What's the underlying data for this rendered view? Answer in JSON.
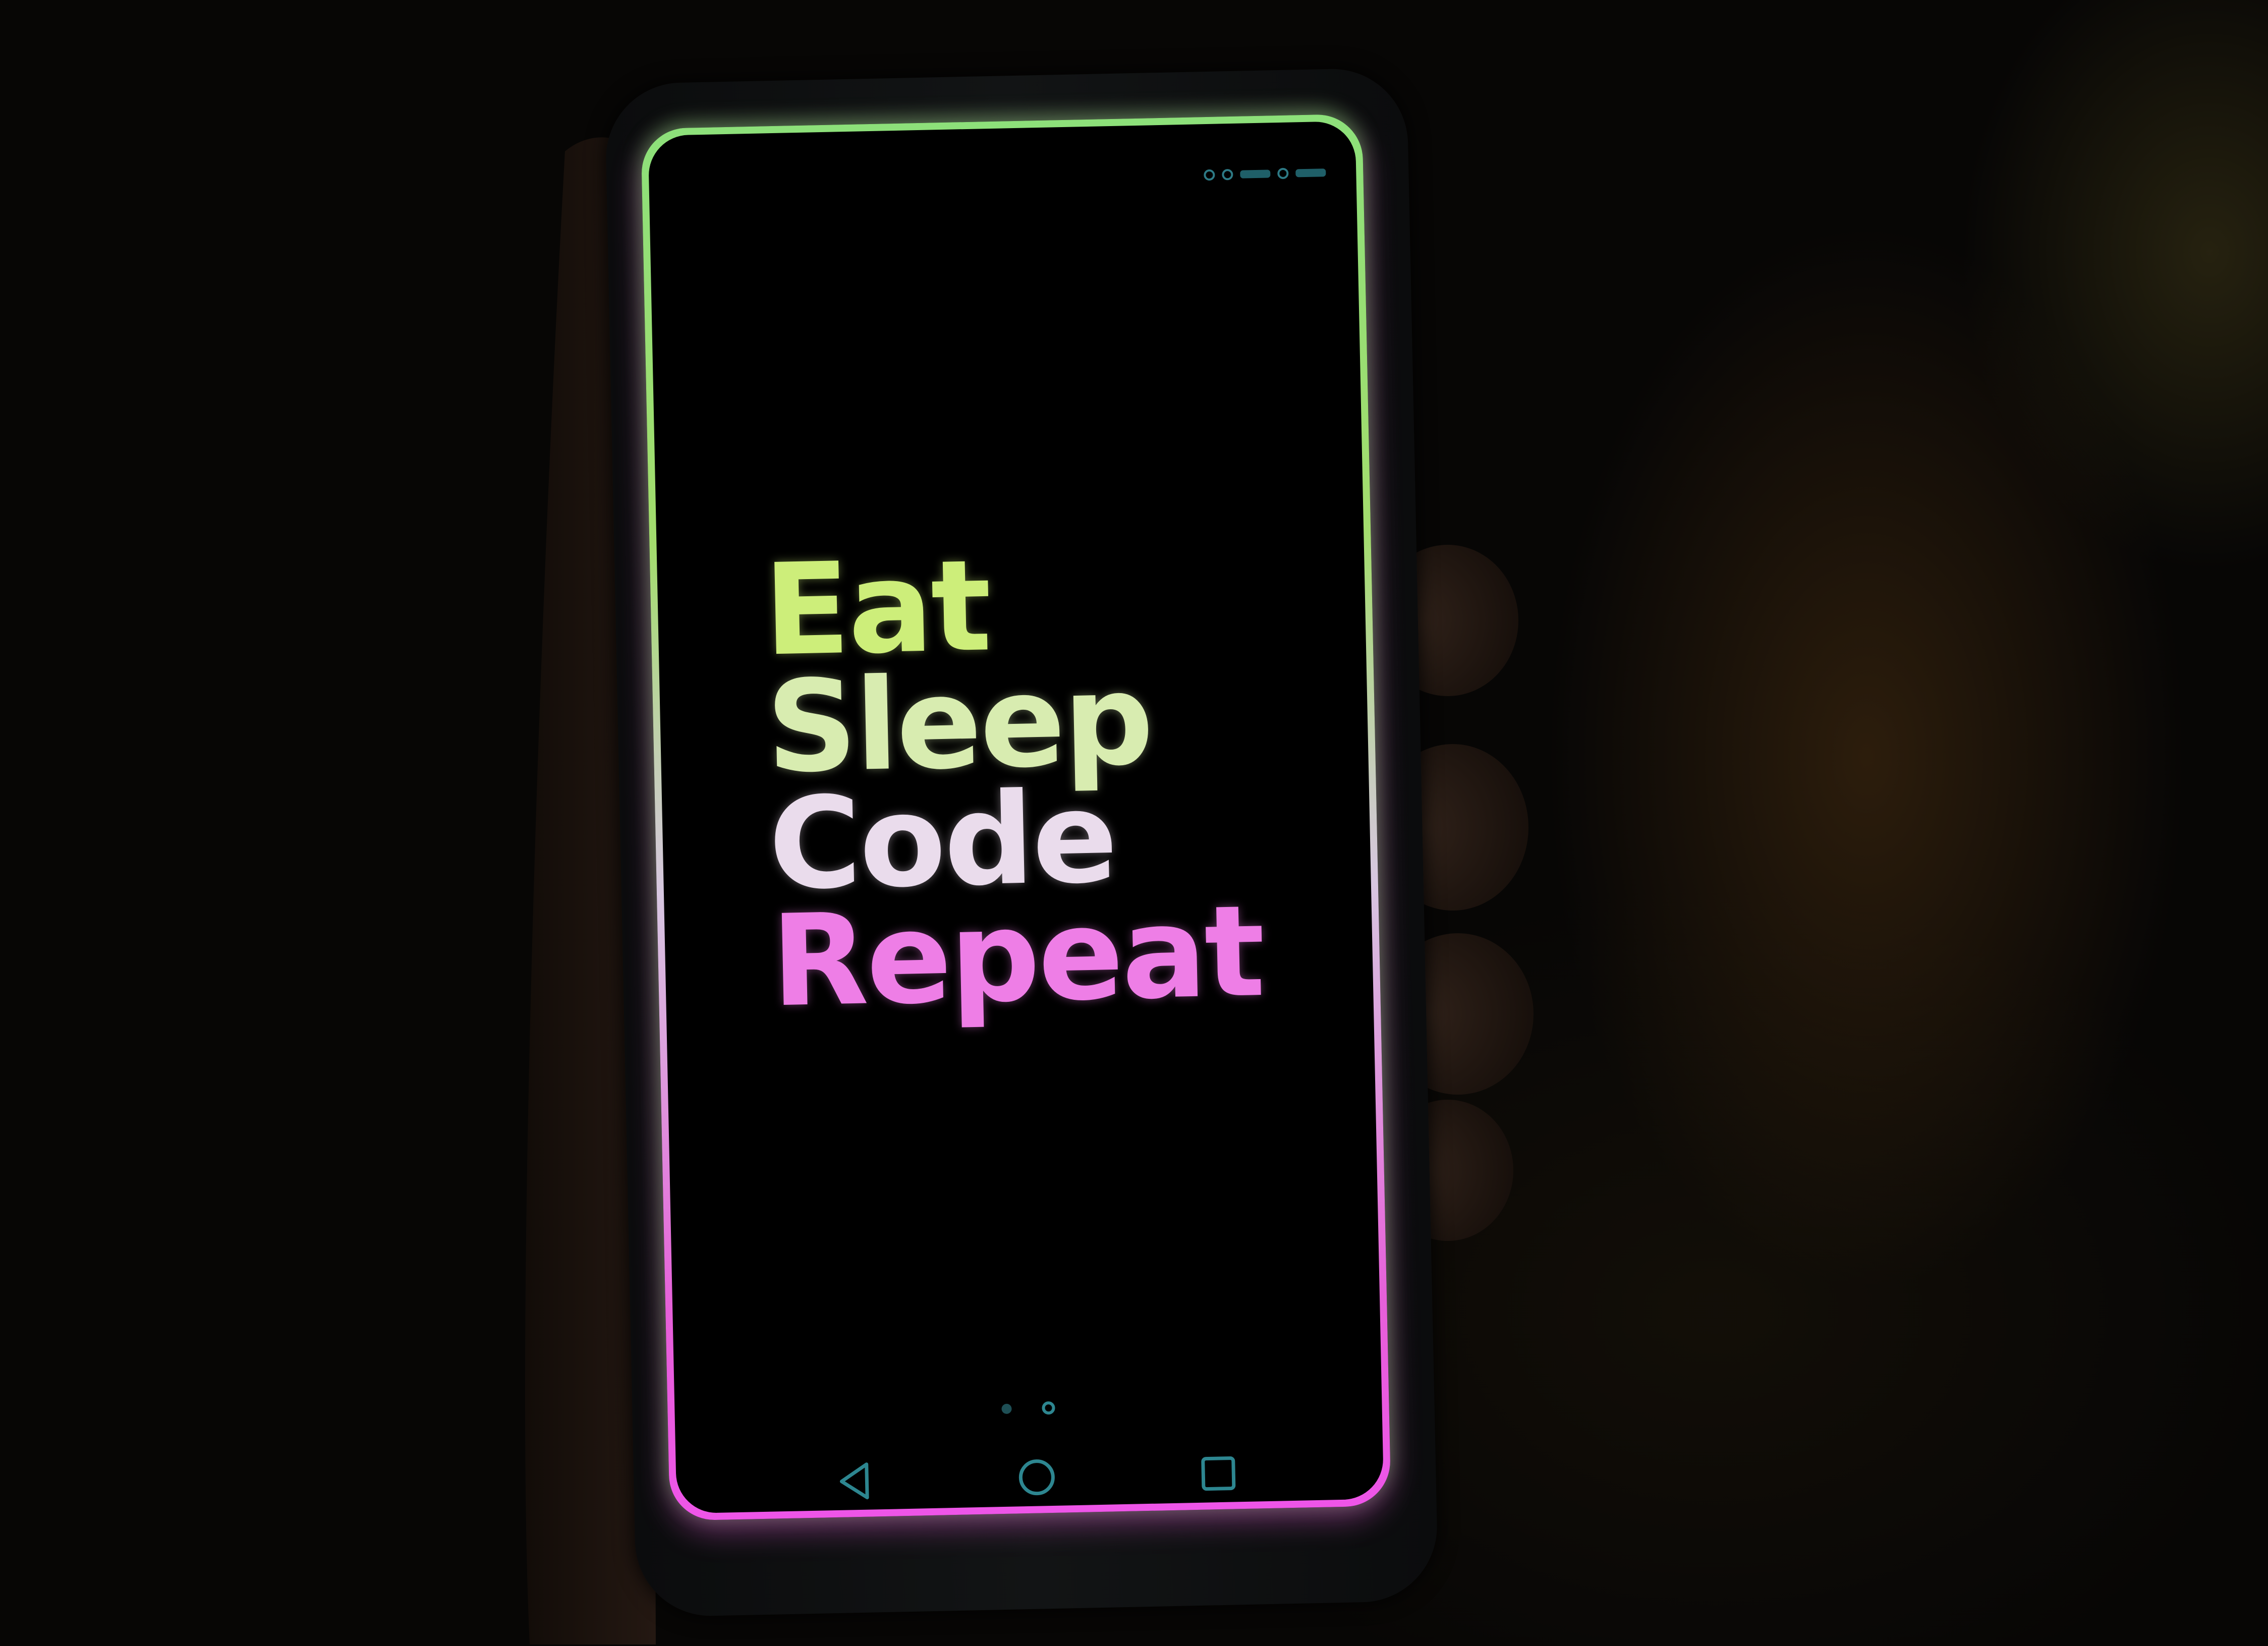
{
  "screen": {
    "slogan": {
      "lines": [
        "Eat",
        "Sleep",
        "Code",
        "Repeat"
      ],
      "colors": [
        "#cdee7a",
        "#d8ecb0",
        "#eadcec",
        "#ee7ee6"
      ]
    },
    "page_indicator": {
      "count": 2,
      "active": 0
    },
    "navigation": {
      "back_icon": "back-triangle-icon",
      "home_icon": "home-circle-icon",
      "recents_icon": "recents-square-icon"
    },
    "accent_colors": {
      "frame_top": "#8de07a",
      "frame_bottom": "#ee55e8",
      "system_ui": "#2d8690"
    }
  }
}
